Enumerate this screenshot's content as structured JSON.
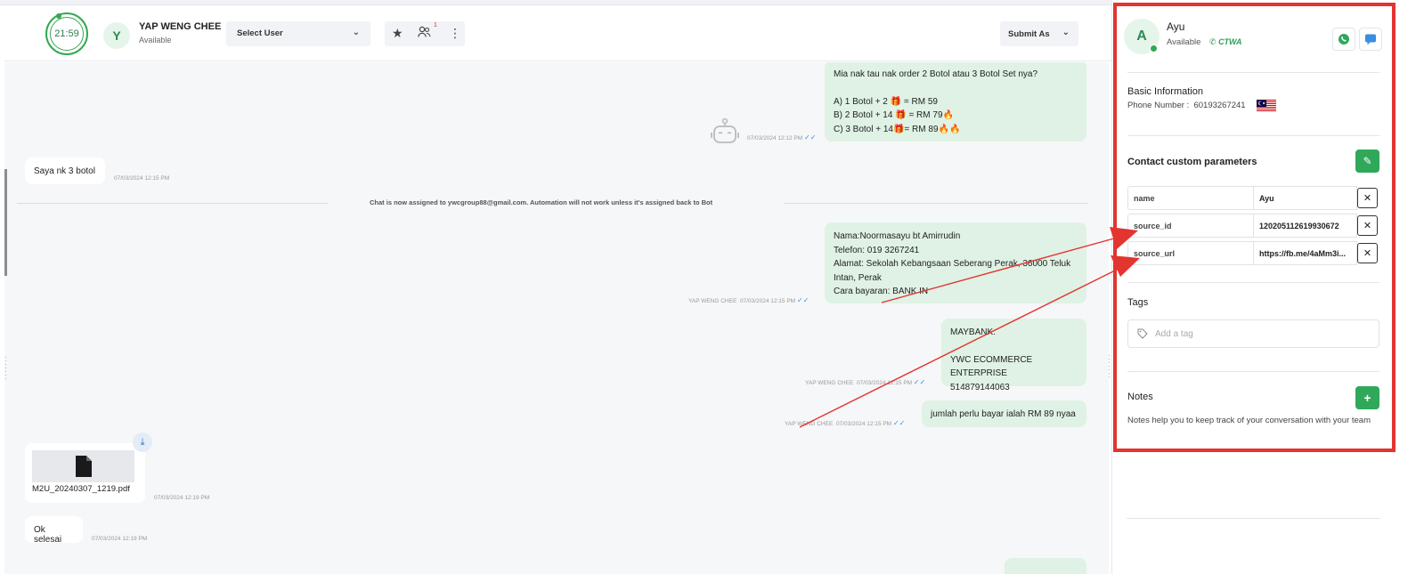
{
  "header": {
    "timer": "21:59",
    "agent_initial": "Y",
    "agent_name": "YAP WENG CHEE",
    "agent_status": "Available",
    "select_user": "Select User",
    "notif_count": "1",
    "submit_as": "Submit As"
  },
  "messages": {
    "m1_lines": [
      "Mia nak tau nak order 2 Botol atau 3 Botol Set nya?",
      "",
      "A) 1 Botol + 2 🎁 = RM 59",
      "B) 2 Botol + 14 🎁 =  RM 79🔥",
      "C) 3 Botol + 14🎁= RM 89🔥🔥"
    ],
    "m1_time": "07/03/2024 12:12 PM",
    "m2_text": "Saya nk 3 botol",
    "m2_time": "07/03/2024 12:15 PM",
    "system_text": "Chat is now assigned to ywcgroup88@gmail.com. Automation will not work unless it's assigned back to Bot",
    "m3_lines": [
      "Nama:Noormasayu bt Amirrudin",
      "Telefon: 019 3267241",
      "Alamat: Sekolah Kebangsaan Seberang Perak, 36000 Teluk",
      "Intan, Perak",
      "Cara bayaran: BANK IN"
    ],
    "m3_sender": "YAP WENG CHEE",
    "m3_time": "07/03/2024 12:15 PM",
    "m4_lines": [
      "MAYBANK:",
      "",
      "YWC ECOMMERCE ENTERPRISE",
      "514879144063"
    ],
    "m4_sender": "YAP WENG CHEE",
    "m4_time": "07/03/2024 12:15 PM",
    "m5_text": "jumlah perlu bayar ialah RM 89 nyaa",
    "m5_sender": "YAP WENG CHEE",
    "m5_time": "07/03/2024 12:15 PM",
    "file_name": "M2U_20240307_1219.pdf",
    "file_time": "07/03/2024 12:19 PM",
    "m6_text": "Ok selesai",
    "m6_time": "07/03/2024 12:19 PM"
  },
  "contact": {
    "initial": "A",
    "name": "Ayu",
    "status": "Available",
    "channel": "CTWA",
    "basic_info_title": "Basic Information",
    "phone_label": "Phone Number :",
    "phone_value": "60193267241",
    "custom_params_title": "Contact custom parameters",
    "params": [
      {
        "key": "name",
        "value": "Ayu"
      },
      {
        "key": "source_id",
        "value": "120205112619930672"
      },
      {
        "key": "source_url",
        "value": "https://fb.me/4aMm3i..."
      }
    ],
    "tags_title": "Tags",
    "tag_placeholder": "Add a tag",
    "notes_title": "Notes",
    "notes_help": "Notes help you to keep track of your conversation with your team"
  },
  "colors": {
    "accent_green": "#2fa85a",
    "highlight_red": "#e3342f",
    "outgoing_bubble": "#dff2e5"
  }
}
